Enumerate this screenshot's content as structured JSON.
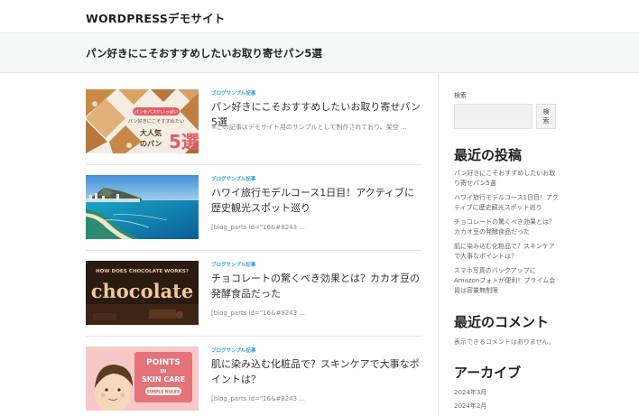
{
  "header": {
    "site_title": "WORDPRESSデモサイト"
  },
  "banner": {
    "title": "パン好きにこそおすすめしたいお取り寄せパン5選"
  },
  "posts": [
    {
      "category": "ブログサンプル記事",
      "title": "パン好きにこそおすすめしたいお取り寄せパン5選",
      "excerpt": "※この記事はデモサイト用のサンプルとして制作されており、架空 ...",
      "thumb_text": {
        "badge": "パンをバスケいっぱい",
        "line1": "パン好きにこそすすめたい",
        "line2a": "大人気",
        "line2b": "のパン",
        "big": "5選"
      }
    },
    {
      "category": "ブログサンプル記事",
      "title": "ハワイ旅行モデルコース1日目！アクティブに歴史観光スポット巡り",
      "excerpt": "[blog_parts id=\"16&#8243 ..."
    },
    {
      "category": "ブログサンプル記事",
      "title": "チョコレートの驚くべき効果とは？カカオ豆の発酵食品だった",
      "excerpt": "[blog_parts id=\"16&#8243 ...",
      "thumb_text": {
        "small": "HOW DOES CHOCOLATE WORKS?",
        "big": "chocolate"
      }
    },
    {
      "category": "ブログサンプル記事",
      "title": "肌に染み込む化粧品で？スキンケアで大事なポイントは？",
      "excerpt": "[blog_parts id=\"16&#8243 ...",
      "thumb_text": {
        "l1": "POINTS",
        "l2": "IN",
        "l3": "SKIN CARE",
        "l4": "SIMPLE RULES"
      }
    }
  ],
  "sidebar": {
    "search_label": "検索",
    "search_placeholder": "",
    "search_button_label": "検\n索",
    "recent_posts_title": "最近の投稿",
    "recent_posts": [
      "パン好きにこそおすすめしたいお取り寄せパン5選",
      "ハワイ旅行モデルコース1日目！アクティブに歴史観光スポット巡り",
      "チョコレートの驚くべき効果とは？カカオ豆の発酵食品だった",
      "肌に染み込む化粧品で？スキンケアで大事なポイントは？",
      "スマホ写真のバックアップにAmazonフォトが便利！プライム会員は容量無制限"
    ],
    "recent_comments_title": "最近のコメント",
    "no_comments_text": "表示できるコメントはありません。",
    "archive_title": "アーカイブ",
    "archives": [
      "2024年3月",
      "2024年2月"
    ]
  },
  "colors": {
    "category": "#2e9fd0",
    "banner_bg": "#f7f8f8"
  }
}
